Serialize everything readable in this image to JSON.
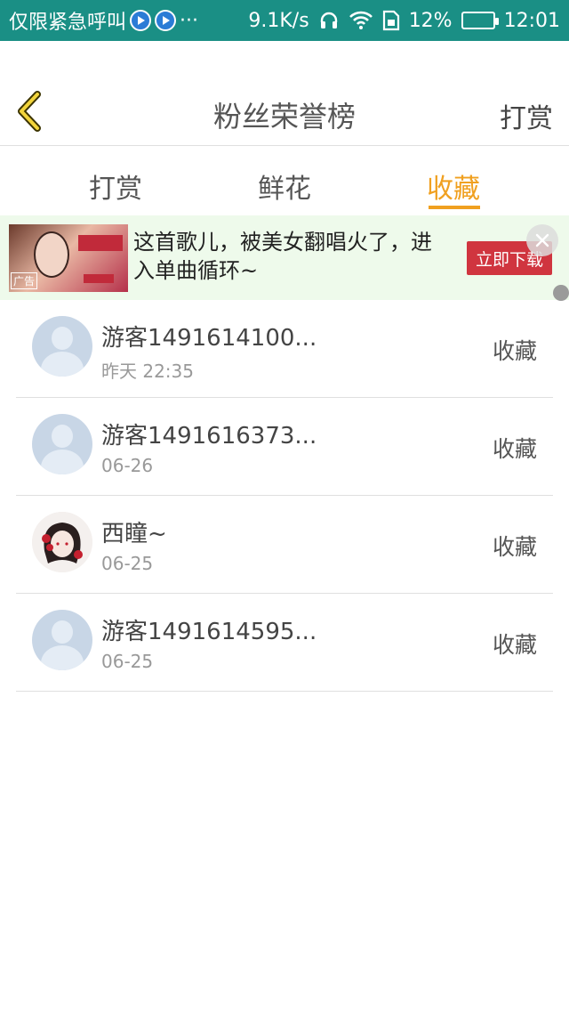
{
  "status_bar": {
    "left_text": "仅限紧急呼叫",
    "dots": "···",
    "speed": "9.1K/s",
    "battery": "12%",
    "time": "12:01",
    "icons": [
      "app-icon",
      "app-icon",
      "headphones-icon",
      "wifi-icon",
      "sim-icon",
      "battery-icon"
    ]
  },
  "header": {
    "back_icon": "chevron-left-icon",
    "title": "粉丝荣誉榜",
    "right_action": "打赏"
  },
  "tabs": [
    {
      "label": "打赏",
      "active": false
    },
    {
      "label": "鲜花",
      "active": false
    },
    {
      "label": "收藏",
      "active": true
    }
  ],
  "ad": {
    "tag": "广告",
    "text": "这首歌儿，被美女翻唱火了，进入单曲循环~",
    "button": "立即下载",
    "close_icon": "close-icon"
  },
  "list": [
    {
      "name": "游客1491614100...",
      "time": "昨天 22:35",
      "action": "收藏",
      "avatar": "default"
    },
    {
      "name": "游客1491616373...",
      "time": "06-26",
      "action": "收藏",
      "avatar": "default"
    },
    {
      "name": "西瞳~",
      "time": "06-25",
      "action": "收藏",
      "avatar": "custom"
    },
    {
      "name": "游客1491614595...",
      "time": "06-25",
      "action": "收藏",
      "avatar": "default"
    }
  ],
  "colors": {
    "status_bar": "#1a8f85",
    "accent": "#f0a020",
    "ad_button": "#d0353f"
  }
}
